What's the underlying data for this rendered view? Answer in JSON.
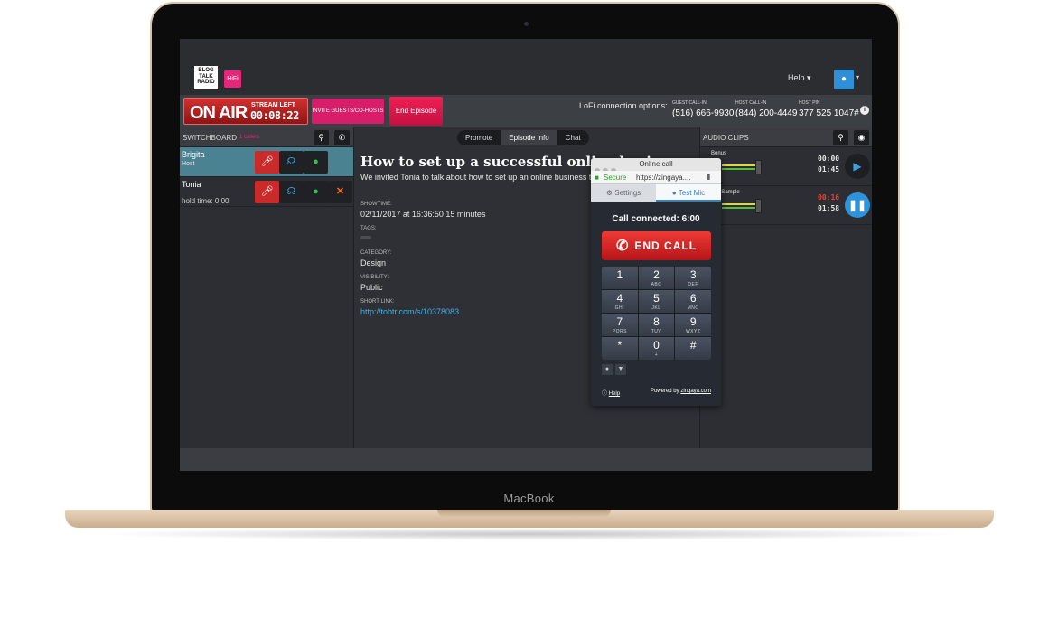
{
  "device": {
    "brand": "MacBook"
  },
  "header": {
    "logo_lines": [
      "BLOG",
      "TALK",
      "RADIO"
    ],
    "hifi_label": "HiFi",
    "help_label": "Help ▾",
    "avatar_icon": "person-icon",
    "avatar_caret": "▾"
  },
  "onair": {
    "label": "ON AIR",
    "stream_left_label": "STREAM LEFT",
    "stream_time": "00:08:22",
    "invite_label": "INVITE GUESTS/CO-HOSTS",
    "end_episode_label": "End Episode",
    "lofi_label": "LoFi connection options:",
    "guest_callin_label": "GUEST CALL-IN",
    "guest_callin_number": "(516) 666-9930",
    "host_callin_label": "HOST CALL-IN",
    "host_callin_number": "(844) 200-4449",
    "host_pin_label": "HOST PIN",
    "host_pin_value": "377 525 1047#",
    "info_icon": "i"
  },
  "switchboard": {
    "title": "SWITCHBOARD",
    "subtitle": "1 callers",
    "callers": [
      {
        "name": "Brigita",
        "sub": "Host"
      },
      {
        "name": "Tonia",
        "sub": "hold time: 0:00"
      }
    ]
  },
  "episode": {
    "tabs": [
      "Promote",
      "Episode Info",
      "Chat"
    ],
    "active_tab": "Episode Info",
    "title": "How to set up a successful online business with Tonia",
    "description": "We invited Tonia to talk about how to set up an online business that... thought.",
    "showtime_label": "SHOWTIME:",
    "showtime_value": "02/11/2017 at 16:36:50 15 minutes",
    "tags_label": "TAGS:",
    "category_label": "CATEGORY:",
    "category_value": "Design",
    "visibility_label": "VISIBILITY:",
    "visibility_value": "Public",
    "short_link_label": "SHORT LINK:",
    "short_link_value": "http://tobtr.com/s/10378083"
  },
  "audio_clips": {
    "title": "AUDIO CLIPS",
    "clips": [
      {
        "name": "Bonus",
        "time_top": "00:00",
        "time_bottom": "01:45",
        "time_top_color": "#e6e6e6",
        "state": "play"
      },
      {
        "name": "...io Sample",
        "time_top": "00:16",
        "time_bottom": "01:58",
        "time_top_color": "#e8433a",
        "state": "pause"
      }
    ]
  },
  "call_popup": {
    "window_title": "Online call",
    "secure_label": "Secure",
    "url": "https://zingaya....",
    "settings_tab": "Settings",
    "test_mic_tab": "Test Mic",
    "status": "Call connected: 6:00",
    "end_call_label": "END CALL",
    "keys": [
      {
        "d": "1",
        "l": ""
      },
      {
        "d": "2",
        "l": "ABC"
      },
      {
        "d": "3",
        "l": "DEF"
      },
      {
        "d": "4",
        "l": "GHI"
      },
      {
        "d": "5",
        "l": "JKL"
      },
      {
        "d": "6",
        "l": "MNO"
      },
      {
        "d": "7",
        "l": "PQRS"
      },
      {
        "d": "8",
        "l": "TUV"
      },
      {
        "d": "9",
        "l": "WXYZ"
      },
      {
        "d": "*",
        "l": ""
      },
      {
        "d": "0",
        "l": "+"
      },
      {
        "d": "#",
        "l": ""
      }
    ],
    "help_label": "Help",
    "powered_by_prefix": "Powered by ",
    "powered_by_link": "zingaya.com"
  },
  "colors": {
    "onair_red": "#d23130",
    "accent_pink": "#e4277a",
    "accent_blue": "#2d94dc",
    "end_call_red": "#ef3a34"
  }
}
